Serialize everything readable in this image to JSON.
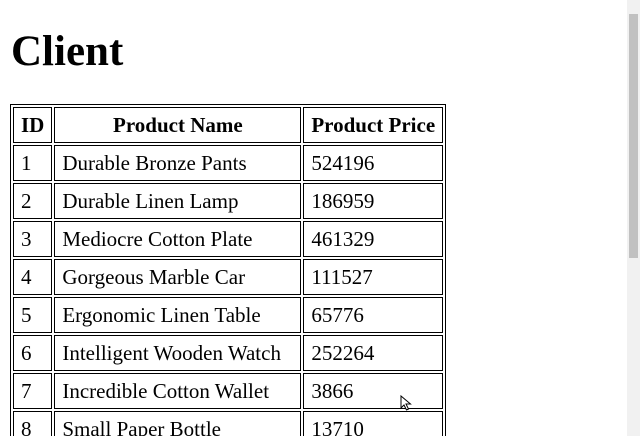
{
  "page": {
    "title": "Client"
  },
  "table": {
    "headers": [
      "ID",
      "Product Name",
      "Product Price"
    ],
    "rows": [
      {
        "id": "1",
        "name": "Durable Bronze Pants",
        "price": "524196"
      },
      {
        "id": "2",
        "name": "Durable Linen Lamp",
        "price": "186959"
      },
      {
        "id": "3",
        "name": "Mediocre Cotton Plate",
        "price": "461329"
      },
      {
        "id": "4",
        "name": "Gorgeous Marble Car",
        "price": "111527"
      },
      {
        "id": "5",
        "name": "Ergonomic Linen Table",
        "price": "65776"
      },
      {
        "id": "6",
        "name": "Intelligent Wooden Watch",
        "price": "252264"
      },
      {
        "id": "7",
        "name": "Incredible Cotton Wallet",
        "price": "3866"
      },
      {
        "id": "8",
        "name": "Small Paper Bottle",
        "price": "13710"
      }
    ]
  },
  "icons": {
    "cursor": "mouse-pointer-icon"
  }
}
